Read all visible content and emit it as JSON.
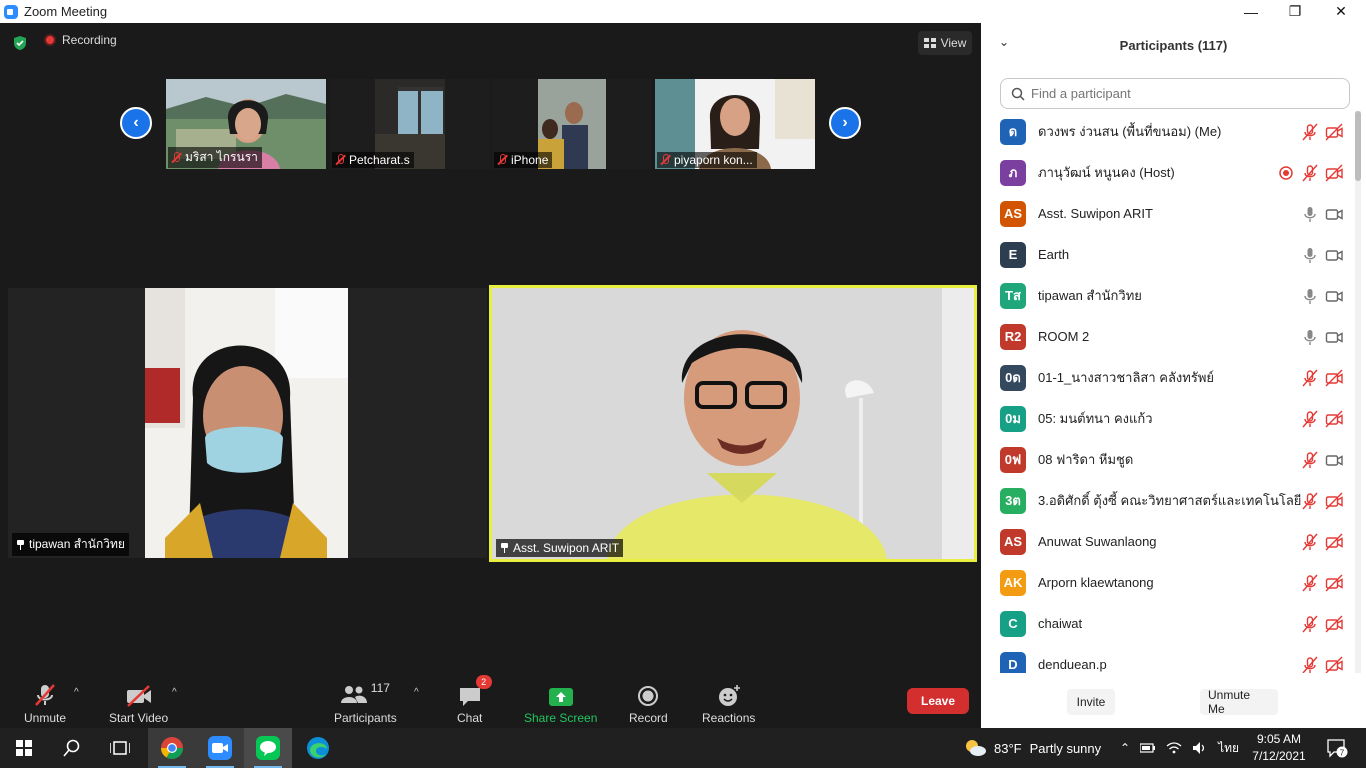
{
  "window": {
    "title": "Zoom Meeting",
    "min": "—",
    "max": "❐",
    "close": "✕"
  },
  "meeting": {
    "recording_label": "Recording",
    "view_label": "View",
    "thumbnails": [
      {
        "name": "มริสา ไกรนรา"
      },
      {
        "name": "Petcharat.s"
      },
      {
        "name": "iPhone"
      },
      {
        "name": "piyaporn kon..."
      }
    ],
    "tiles": [
      {
        "name": "tipawan สำนักวิทย"
      },
      {
        "name": "Asst. Suwipon ARIT"
      }
    ]
  },
  "toolbar": {
    "unmute": "Unmute",
    "start_video": "Start Video",
    "participants": "Participants",
    "participants_count": "117",
    "chat": "Chat",
    "chat_badge": "2",
    "share_screen": "Share Screen",
    "record": "Record",
    "reactions": "Reactions",
    "leave": "Leave",
    "colors": {
      "share": "#22b14c",
      "leave": "#d32f2f",
      "muted": "#e53935"
    }
  },
  "participants_panel": {
    "title": "Participants (117)",
    "search_placeholder": "Find a participant",
    "invite": "Invite",
    "unmute_me": "Unmute Me",
    "rows": [
      {
        "initials": "ด",
        "color": "#1e63b6",
        "name": "ดวงพร ง่วนสน (พื้นที่ขนอม) (Me)",
        "mic": "muted",
        "video": "off",
        "rec": false
      },
      {
        "initials": "ภ",
        "color": "#7b3fa0",
        "name": "ภานุวัฒน์ หนูนคง (Host)",
        "mic": "muted",
        "video": "off",
        "rec": true
      },
      {
        "initials": "AS",
        "color": "#d35400",
        "name": "Asst. Suwipon ARIT",
        "mic": "on",
        "video": "on",
        "rec": false
      },
      {
        "initials": "E",
        "color": "#2c3e50",
        "name": "Earth",
        "mic": "on",
        "video": "on",
        "rec": false
      },
      {
        "initials": "Tส",
        "color": "#1fa67a",
        "name": "tipawan สำนักวิทย",
        "mic": "on",
        "video": "on",
        "rec": false
      },
      {
        "initials": "R2",
        "color": "#c0392b",
        "name": "ROOM 2",
        "mic": "on",
        "video": "on",
        "rec": false
      },
      {
        "initials": "0ด",
        "color": "#34495e",
        "name": "01-1_นางสาวชาลิสา คลังทรัพย์",
        "mic": "muted",
        "video": "off",
        "rec": false
      },
      {
        "initials": "0ม",
        "color": "#16a085",
        "name": "05: มนต์ทนา คงแก้ว",
        "mic": "muted",
        "video": "off",
        "rec": false
      },
      {
        "initials": "0ฟ",
        "color": "#c0392b",
        "name": "08 ฟาริดา หีมชูด",
        "mic": "muted",
        "video": "on",
        "rec": false
      },
      {
        "initials": "3ต",
        "color": "#27ae60",
        "name": "3.อดิศักดิ์ ตุ้งซี้ คณะวิทยาศาสตร์และเทคโนโลยี",
        "mic": "muted",
        "video": "off",
        "rec": false
      },
      {
        "initials": "AS",
        "color": "#c0392b",
        "name": "Anuwat Suwanlaong",
        "mic": "muted",
        "video": "off",
        "rec": false
      },
      {
        "initials": "AK",
        "color": "#f39c12",
        "name": "Arporn  klaewtanong",
        "mic": "muted",
        "video": "off",
        "rec": false
      },
      {
        "initials": "C",
        "color": "#16a085",
        "name": "chaiwat",
        "mic": "muted",
        "video": "off",
        "rec": false
      },
      {
        "initials": "D",
        "color": "#1e63b6",
        "name": "denduean.p",
        "mic": "muted",
        "video": "off",
        "rec": false
      }
    ]
  },
  "taskbar": {
    "weather_temp": "83°F",
    "weather_text": "Partly sunny",
    "language": "ไทย",
    "time": "9:05 AM",
    "date": "7/12/2021",
    "notifications": "7"
  }
}
